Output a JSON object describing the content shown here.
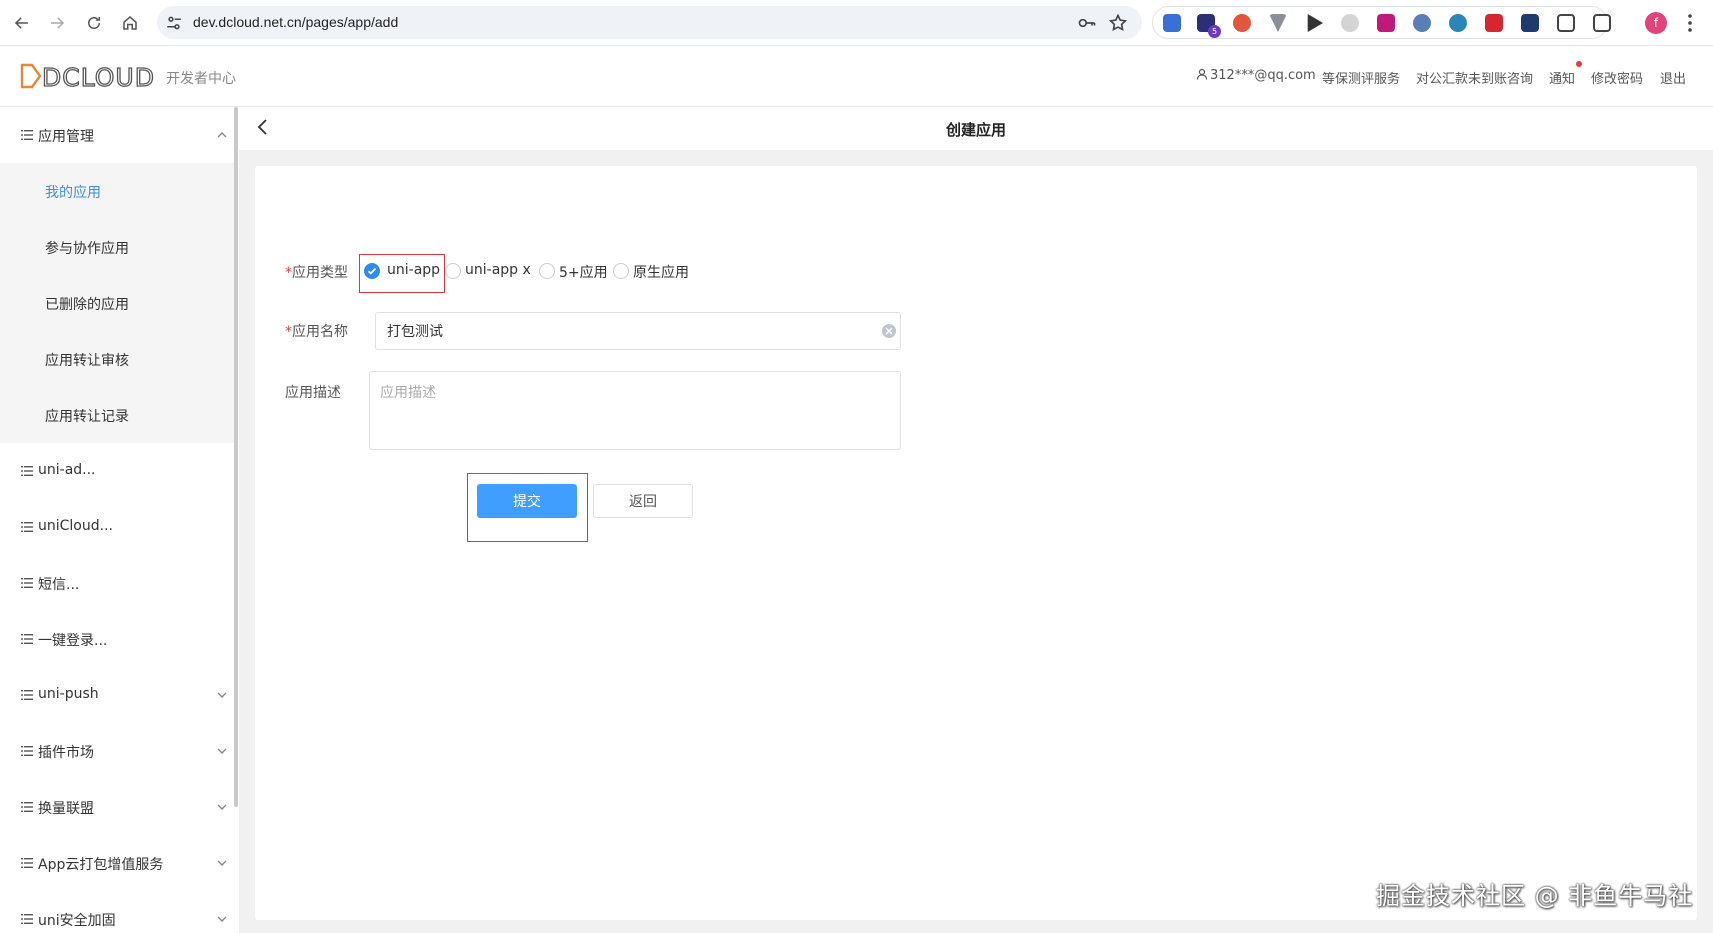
{
  "browser": {
    "url": "dev.dcloud.net.cn/pages/app/add",
    "profile_initial": "f",
    "extension_badge": "5"
  },
  "header": {
    "logo_text": "DCLOUD",
    "subtitle": "开发者中心",
    "user": "312***@qq.com",
    "links": [
      "等保测评服务",
      "对公汇款未到账咨询",
      "通知",
      "修改密码",
      "退出"
    ]
  },
  "sidebar": {
    "groups": [
      {
        "label": "应用管理",
        "expanded": true
      },
      {
        "label": "uni-ad..."
      },
      {
        "label": "uniCloud..."
      },
      {
        "label": "短信..."
      },
      {
        "label": "一键登录..."
      },
      {
        "label": "uni-push"
      },
      {
        "label": "插件市场"
      },
      {
        "label": "换量联盟"
      },
      {
        "label": "App云打包增值服务"
      },
      {
        "label": "uni安全加固"
      }
    ],
    "sub_items": [
      "我的应用",
      "参与协作应用",
      "已删除的应用",
      "应用转让审核",
      "应用转让记录"
    ],
    "active_sub": "我的应用"
  },
  "page": {
    "title": "创建应用"
  },
  "form": {
    "type_label": "应用类型",
    "type_options": [
      "uni-app",
      "uni-app x",
      "5+应用",
      "原生应用"
    ],
    "type_selected": "uni-app",
    "name_label": "应用名称",
    "name_value": "打包测试",
    "desc_label": "应用描述",
    "desc_placeholder": "应用描述",
    "submit_label": "提交",
    "return_label": "返回",
    "required_mark": "*"
  },
  "watermark": "掘金技术社区 @ 非鱼牛马社",
  "colors": {
    "primary": "#409eff",
    "active_menu": "#3a8ee6",
    "highlight": "#d9363e"
  }
}
